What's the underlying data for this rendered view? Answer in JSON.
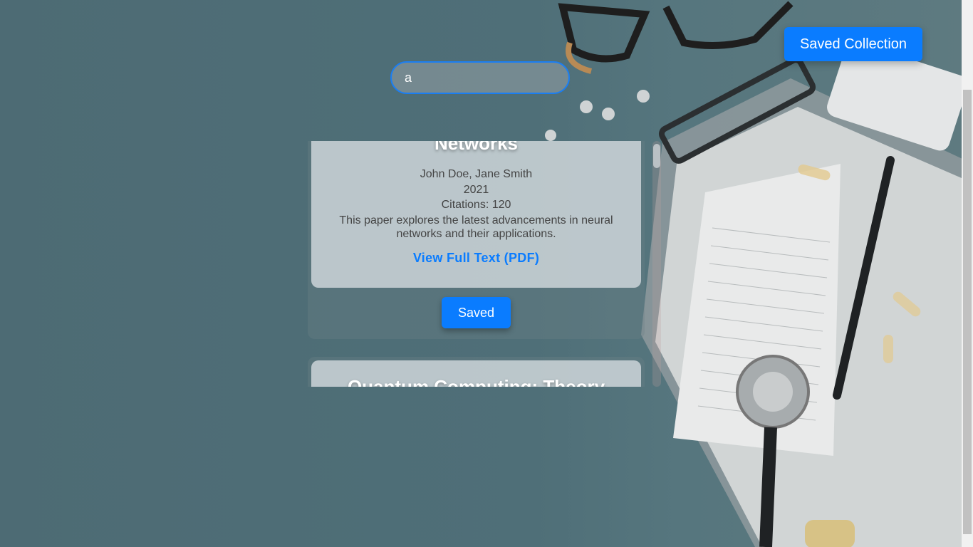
{
  "header": {
    "saved_collection_label": "Saved Collection"
  },
  "search": {
    "value": "a",
    "placeholder": ""
  },
  "results": [
    {
      "title": "Networks",
      "authors": "John Doe, Jane Smith",
      "year": "2021",
      "citations": "Citations: 120",
      "abstract": "This paper explores the latest advancements in neural networks and their applications.",
      "pdf_link": "View Full Text (PDF)",
      "save_label": "Saved"
    },
    {
      "title": "Quantum Computing: Theory"
    }
  ],
  "colors": {
    "accent": "#0a7cff",
    "input_border": "#1b7ef2"
  },
  "icons": {
    "background": "desk-glasses-clipboard-stethoscope-image"
  }
}
